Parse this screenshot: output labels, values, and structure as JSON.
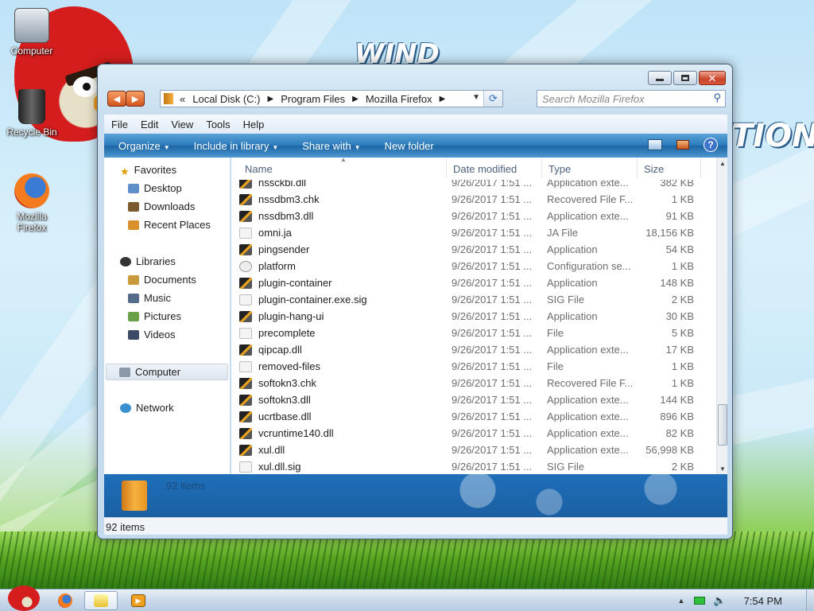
{
  "desktop": {
    "icons": [
      {
        "label": "Computer"
      },
      {
        "label": "Recycle Bin"
      },
      {
        "label": "Mozilla\nFirefox"
      }
    ],
    "wallpaper_text": [
      "WIND",
      "TION"
    ]
  },
  "window": {
    "address": {
      "overflow": "«",
      "crumbs": [
        "Local Disk (C:)",
        "Program Files",
        "Mozilla Firefox"
      ]
    },
    "search_placeholder": "Search Mozilla Firefox",
    "menu": [
      "File",
      "Edit",
      "View",
      "Tools",
      "Help"
    ],
    "commands": [
      "Organize",
      "Include in library",
      "Share with",
      "New folder"
    ],
    "nav": {
      "favorites": "Favorites",
      "fav_items": [
        "Desktop",
        "Downloads",
        "Recent Places"
      ],
      "libraries": "Libraries",
      "lib_items": [
        "Documents",
        "Music",
        "Pictures",
        "Videos"
      ],
      "computer": "Computer",
      "network": "Network"
    },
    "columns": [
      "Name",
      "Date modified",
      "Type",
      "Size"
    ],
    "files": [
      {
        "name": "nssckbi.dll",
        "date": "9/26/2017 1:51 ...",
        "type": "Application exte...",
        "size": "382 KB",
        "icon": "app"
      },
      {
        "name": "nssdbm3.chk",
        "date": "9/26/2017 1:51 ...",
        "type": "Recovered File F...",
        "size": "1 KB",
        "icon": "app"
      },
      {
        "name": "nssdbm3.dll",
        "date": "9/26/2017 1:51 ...",
        "type": "Application exte...",
        "size": "91 KB",
        "icon": "app"
      },
      {
        "name": "omni.ja",
        "date": "9/26/2017 1:51 ...",
        "type": "JA File",
        "size": "18,156 KB",
        "icon": "doc"
      },
      {
        "name": "pingsender",
        "date": "9/26/2017 1:51 ...",
        "type": "Application",
        "size": "54 KB",
        "icon": "app"
      },
      {
        "name": "platform",
        "date": "9/26/2017 1:51 ...",
        "type": "Configuration se...",
        "size": "1 KB",
        "icon": "cfg"
      },
      {
        "name": "plugin-container",
        "date": "9/26/2017 1:51 ...",
        "type": "Application",
        "size": "148 KB",
        "icon": "app"
      },
      {
        "name": "plugin-container.exe.sig",
        "date": "9/26/2017 1:51 ...",
        "type": "SIG File",
        "size": "2 KB",
        "icon": "doc"
      },
      {
        "name": "plugin-hang-ui",
        "date": "9/26/2017 1:51 ...",
        "type": "Application",
        "size": "30 KB",
        "icon": "app"
      },
      {
        "name": "precomplete",
        "date": "9/26/2017 1:51 ...",
        "type": "File",
        "size": "5 KB",
        "icon": "doc"
      },
      {
        "name": "qipcap.dll",
        "date": "9/26/2017 1:51 ...",
        "type": "Application exte...",
        "size": "17 KB",
        "icon": "app"
      },
      {
        "name": "removed-files",
        "date": "9/26/2017 1:51 ...",
        "type": "File",
        "size": "1 KB",
        "icon": "doc"
      },
      {
        "name": "softokn3.chk",
        "date": "9/26/2017 1:51 ...",
        "type": "Recovered File F...",
        "size": "1 KB",
        "icon": "app"
      },
      {
        "name": "softokn3.dll",
        "date": "9/26/2017 1:51 ...",
        "type": "Application exte...",
        "size": "144 KB",
        "icon": "app"
      },
      {
        "name": "ucrtbase.dll",
        "date": "9/26/2017 1:51 ...",
        "type": "Application exte...",
        "size": "896 KB",
        "icon": "app"
      },
      {
        "name": "vcruntime140.dll",
        "date": "9/26/2017 1:51 ...",
        "type": "Application exte...",
        "size": "82 KB",
        "icon": "app"
      },
      {
        "name": "xul.dll",
        "date": "9/26/2017 1:51 ...",
        "type": "Application exte...",
        "size": "56,998 KB",
        "icon": "app"
      },
      {
        "name": "xul.dll.sig",
        "date": "9/26/2017 1:51 ...",
        "type": "SIG File",
        "size": "2 KB",
        "icon": "doc"
      }
    ],
    "details_count": "92 items",
    "status_count": "92 items"
  },
  "taskbar": {
    "clock": "7:54 PM",
    "tray_arrow": "▲"
  },
  "colors": {
    "accent_orange": "#d2541e",
    "command_bar_blue": "#2c7bbd",
    "close_red": "#c9452a"
  }
}
